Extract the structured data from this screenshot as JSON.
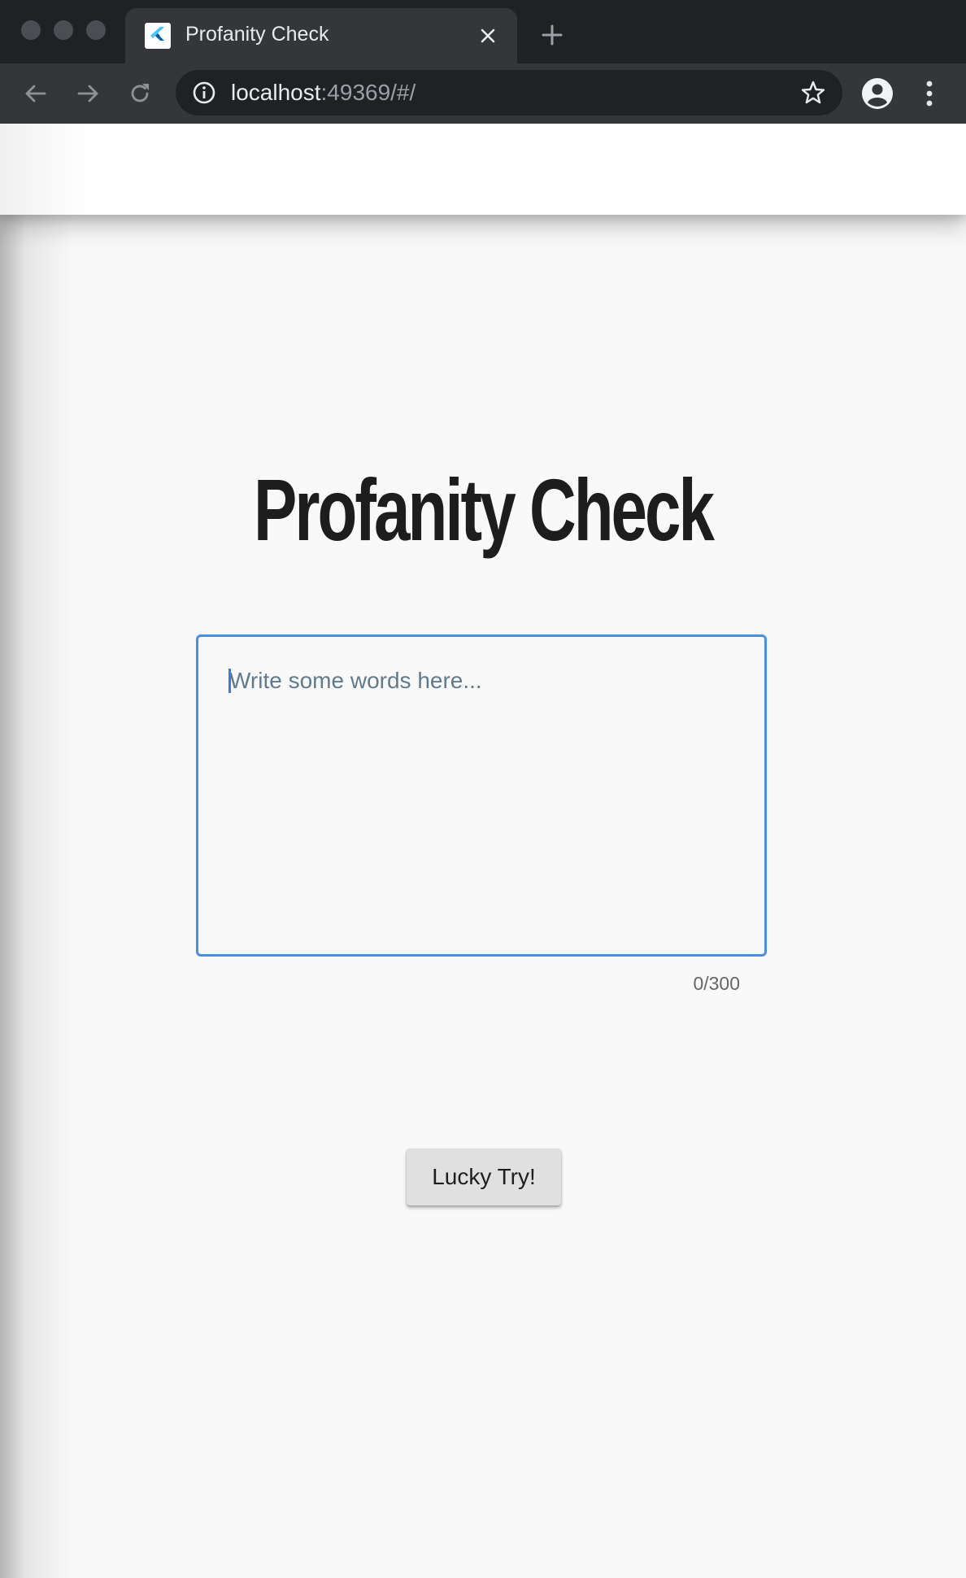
{
  "browser": {
    "tab_title": "Profanity Check",
    "url_host": "localhost",
    "url_rest": ":49369/#/"
  },
  "page": {
    "title": "Profanity Check",
    "input_placeholder": "Write some words here...",
    "char_counter": "0/300",
    "button_label": "Lucky Try!"
  },
  "icons": {
    "favicon": "flutter-logo-icon",
    "close": "close-icon",
    "new_tab": "plus-icon",
    "back": "arrow-left-icon",
    "forward": "arrow-right-icon",
    "reload": "reload-icon",
    "info": "info-icon",
    "bookmark": "star-icon",
    "profile": "account-circle-icon",
    "menu": "more-vert-icon"
  },
  "colors": {
    "input_focus_border": "#4a90e2",
    "button_bg": "#e0e0e0",
    "title_text": "#1d1d1d"
  }
}
